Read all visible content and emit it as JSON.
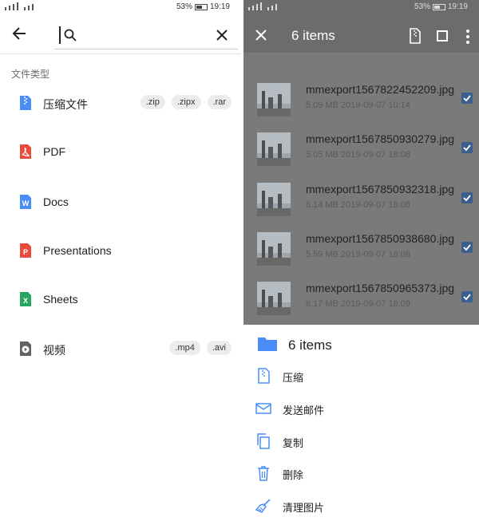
{
  "left": {
    "status": {
      "battery": "53%",
      "time": "19:19"
    },
    "search": {
      "value": "",
      "placeholder": ""
    },
    "section_title": "文件类型",
    "types": [
      {
        "label": "压缩文件",
        "icon": "archive-icon",
        "color": "#4a8df6",
        "chips": [
          ".zip",
          ".zipx",
          ".rar"
        ]
      },
      {
        "label": "PDF",
        "icon": "pdf-icon",
        "color": "#e74c3c",
        "chips": []
      },
      {
        "label": "Docs",
        "icon": "docs-icon",
        "color": "#4a8df6",
        "chips": []
      },
      {
        "label": "Presentations",
        "icon": "slides-icon",
        "color": "#e74c3c",
        "chips": []
      },
      {
        "label": "Sheets",
        "icon": "sheets-icon",
        "color": "#27a660",
        "chips": []
      },
      {
        "label": "视频",
        "icon": "video-icon",
        "color": "#5f6368",
        "chips": [
          ".mp4",
          ".avi"
        ]
      }
    ]
  },
  "right": {
    "status": {
      "battery": "53%",
      "time": "19:19"
    },
    "title": "6 items",
    "files": [
      {
        "name": "mmexport1567822452209.jpg",
        "meta": "5.09 MB 2019-09-07 10:14",
        "checked": true
      },
      {
        "name": "mmexport1567850930279.jpg",
        "meta": "5.05 MB 2019-09-07 18:08",
        "checked": true
      },
      {
        "name": "mmexport1567850932318.jpg",
        "meta": "6.14 MB 2019-09-07 18:08",
        "checked": true
      },
      {
        "name": "mmexport1567850938680.jpg",
        "meta": "5.59 MB 2019-09-07 18:08",
        "checked": true
      },
      {
        "name": "mmexport1567850965373.jpg",
        "meta": "6.17 MB 2019-09-07 18:09",
        "checked": true
      }
    ],
    "sheet": {
      "title": "6 items",
      "actions": [
        {
          "label": "压缩",
          "icon": "compress-icon"
        },
        {
          "label": "发送邮件",
          "icon": "mail-icon"
        },
        {
          "label": "复制",
          "icon": "copy-icon"
        },
        {
          "label": "删除",
          "icon": "trash-icon"
        },
        {
          "label": "清理图片",
          "icon": "broom-icon"
        }
      ]
    }
  }
}
